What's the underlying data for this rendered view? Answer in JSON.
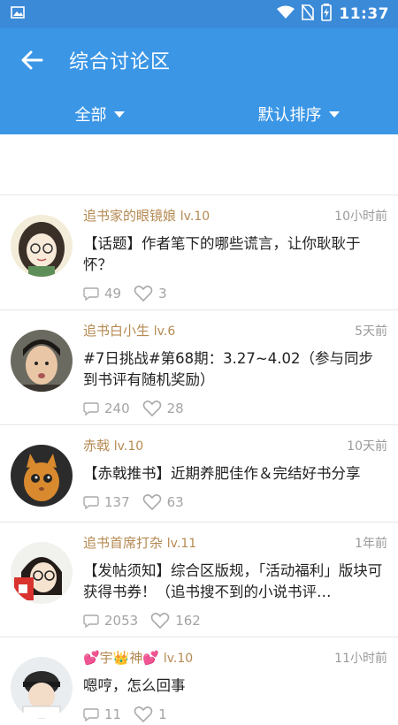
{
  "status_bar": {
    "time": "11:37"
  },
  "header": {
    "title": "综合讨论区"
  },
  "filters": {
    "category": "全部",
    "sort": "默认排序"
  },
  "posts": [
    {
      "username": "追书家的眼镜娘",
      "level": "lv.10",
      "time": "10小时前",
      "title": "【话题】作者笔下的哪些谎言，让你耿耿于怀？",
      "comments": "49",
      "likes": "3"
    },
    {
      "username": "追书白小生",
      "level": "lv.6",
      "time": "5天前",
      "title": "#7日挑战#第68期：3.27~4.02（参与同步到书评有随机奖励）",
      "comments": "240",
      "likes": "28"
    },
    {
      "username": "赤戟",
      "level": "lv.10",
      "time": "10天前",
      "title": "【赤戟推书】近期养肥佳作＆完结好书分享",
      "comments": "137",
      "likes": "63"
    },
    {
      "username": "追书首席打杂",
      "level": "lv.11",
      "time": "1年前",
      "title": "【发帖须知】综合区版规，「活动福利」版块可获得书券！（追书搜不到的小说书评…",
      "comments": "2053",
      "likes": "162"
    },
    {
      "username": "💕宇👑神💕",
      "level": "lv.10",
      "time": "11小时前",
      "title": "嗯哼，怎么回事",
      "comments": "11",
      "likes": "1"
    }
  ]
}
